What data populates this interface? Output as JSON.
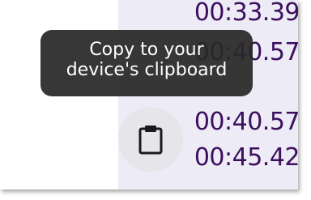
{
  "timestamps": [
    "00:33.39",
    "00:40.57",
    "00:40.57",
    "00:45.42"
  ],
  "tooltip": {
    "line1": "Copy to your",
    "line2": "device's clipboard"
  },
  "copy_button": {
    "icon": "clipboard-icon"
  },
  "colors": {
    "timestamp_text": "#3c0f5e",
    "panel_background": "#ecebf6",
    "tooltip_background": "#282828",
    "button_background": "#e6e6ea"
  }
}
